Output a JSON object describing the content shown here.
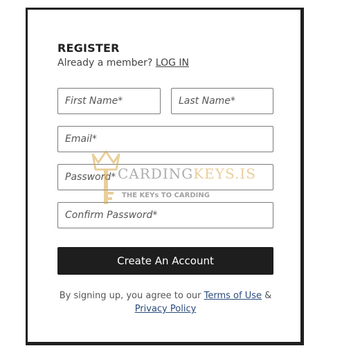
{
  "form": {
    "title": "REGISTER",
    "member_prompt": "Already a member?",
    "login_link": "LOG IN",
    "first_name_placeholder": "First Name*",
    "last_name_placeholder": "Last Name*",
    "email_placeholder": "Email*",
    "password_placeholder": "Password*",
    "confirm_password_placeholder": "Confirm Password*",
    "submit_label": "Create An Account",
    "terms_prefix": "By signing up, you agree to our",
    "terms_link": "Terms of Use",
    "terms_joiner": "&",
    "privacy_link": "Privacy Policy"
  },
  "watermark": {
    "brand_main": "CARDING",
    "brand_accent": "KEYS.IS",
    "tagline": "THE KEYs TO CARDING",
    "icon": "crown-key-icon"
  },
  "colors": {
    "button_bg": "#1e1e1e",
    "link": "#2a4a7a",
    "border": "#1f1f1f",
    "watermark_gold": "#d8a84a"
  }
}
